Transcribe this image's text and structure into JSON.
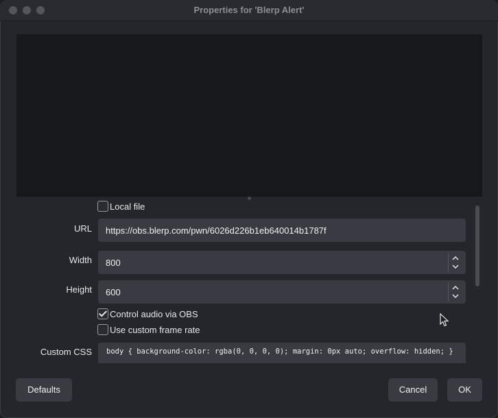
{
  "window": {
    "title": "Properties for 'Blerp Alert'"
  },
  "properties": {
    "local_file": {
      "label": "Local file",
      "checked": false
    },
    "url": {
      "label": "URL",
      "value": "https://obs.blerp.com/pwn/6026d226b1eb640014b1787f"
    },
    "width": {
      "label": "Width",
      "value": "800"
    },
    "height": {
      "label": "Height",
      "value": "600"
    },
    "control_audio": {
      "label": "Control audio via OBS",
      "checked": true
    },
    "custom_frame_rate": {
      "label": "Use custom frame rate",
      "checked": false
    },
    "custom_css": {
      "label": "Custom CSS",
      "value": "body { background-color: rgba(0, 0, 0, 0); margin: 0px auto; overflow: hidden; }"
    }
  },
  "buttons": {
    "defaults": "Defaults",
    "cancel": "Cancel",
    "ok": "OK"
  }
}
